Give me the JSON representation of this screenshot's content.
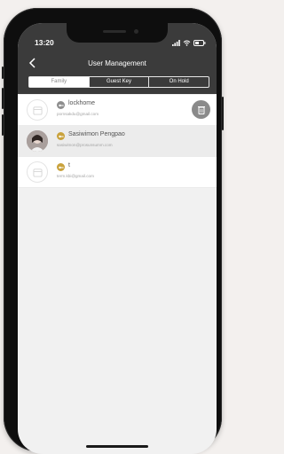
{
  "status_bar": {
    "time": "13:20"
  },
  "header": {
    "title": "User Management",
    "back_icon": "chevron-left-icon"
  },
  "tabs": [
    {
      "label": "Family",
      "active": true
    },
    {
      "label": "Guest Key",
      "active": false
    },
    {
      "label": "On Hold",
      "active": false
    }
  ],
  "users": [
    {
      "name": "lockhome",
      "email": "pornsakdu@gmail.com",
      "badge_color": "#8e8e8e",
      "badge_icon": "key-icon",
      "avatar": "placeholder",
      "has_action": true,
      "action_icon": "trash-icon"
    },
    {
      "name": "Sasiwimon Pengpao",
      "email": "sasiwimon@prosunsumm.com",
      "badge_color": "#c9a23c",
      "badge_icon": "key-icon",
      "avatar": "photo",
      "has_action": false
    },
    {
      "name": "t",
      "email": "term.kbi@gmail.com",
      "badge_color": "#c9a23c",
      "badge_icon": "key-icon",
      "avatar": "placeholder",
      "has_action": false
    }
  ],
  "colors": {
    "header_bg": "#3b3b3b",
    "gold_badge": "#c9a23c",
    "grey_badge": "#8e8e8e"
  }
}
